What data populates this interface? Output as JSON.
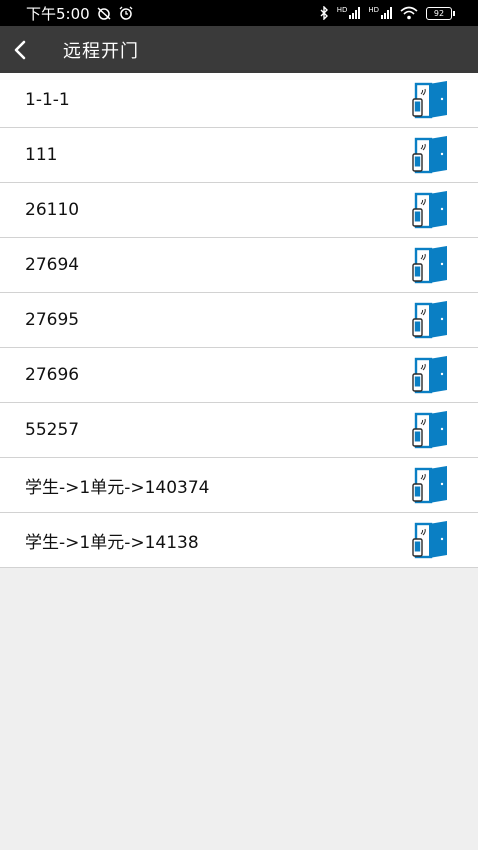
{
  "status_bar": {
    "time": "下午5:00",
    "icons": [
      "alarm-off-icon",
      "alarm-clock-icon",
      "bluetooth-icon",
      "signal-icon",
      "signal-icon",
      "wifi-icon"
    ],
    "hd1": "HD",
    "hd2": "HD",
    "battery": "92"
  },
  "header": {
    "back_icon": "chevron-left-icon",
    "title": "远程开门"
  },
  "doors": [
    {
      "label": "1-1-1"
    },
    {
      "label": "111"
    },
    {
      "label": "26110"
    },
    {
      "label": "27694"
    },
    {
      "label": "27695"
    },
    {
      "label": "27696"
    },
    {
      "label": "55257"
    },
    {
      "label": "学生->1单元->140374"
    },
    {
      "label": "学生->1单元->14138"
    }
  ],
  "door_icon": "remote-door-open-icon",
  "colors": {
    "app_bar": "#3a3a3a",
    "icon_blue": "#0a7fc4",
    "background": "#efefef"
  }
}
